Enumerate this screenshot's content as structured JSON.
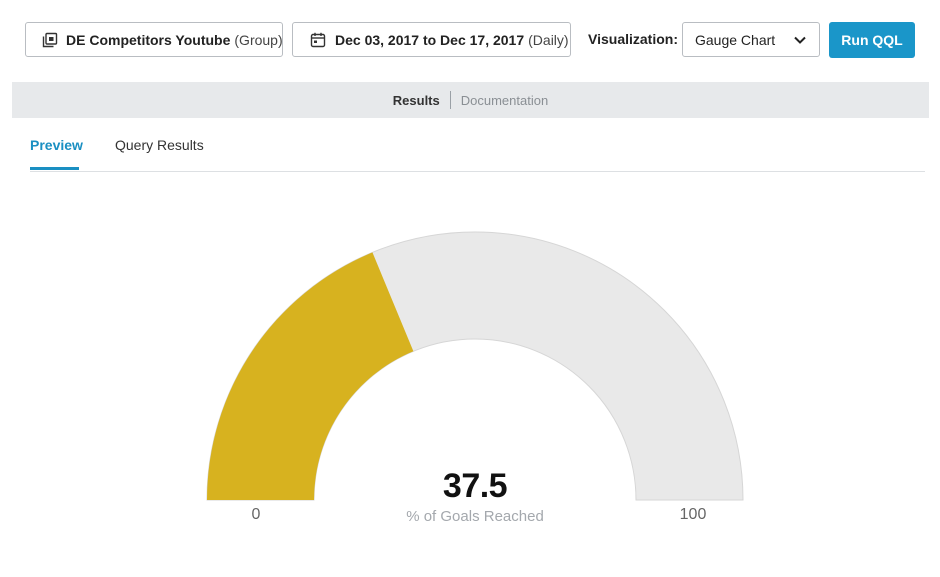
{
  "toolbar": {
    "source_name": "DE Competitors Youtube",
    "source_type": "(Group)",
    "date_range": "Dec 03, 2017 to Dec 17, 2017",
    "date_granularity": "(Daily)",
    "visualization_label": "Visualization:",
    "visualization_value": "Gauge Chart",
    "run_label": "Run QQL"
  },
  "results_bar": {
    "active": "Results",
    "other": "Documentation"
  },
  "tabs": [
    {
      "label": "Preview",
      "active": true
    },
    {
      "label": "Query Results",
      "active": false
    }
  ],
  "colors": {
    "accent": "#1a96c9",
    "gauge_fill": "#d7b21f",
    "gauge_track": "#e9e9e9"
  },
  "chart_data": {
    "type": "gauge",
    "value": 37.5,
    "min": 0,
    "max": 100,
    "value_text": "37.5",
    "min_text": "0",
    "max_text": "100",
    "label": "% of Goals Reached"
  }
}
